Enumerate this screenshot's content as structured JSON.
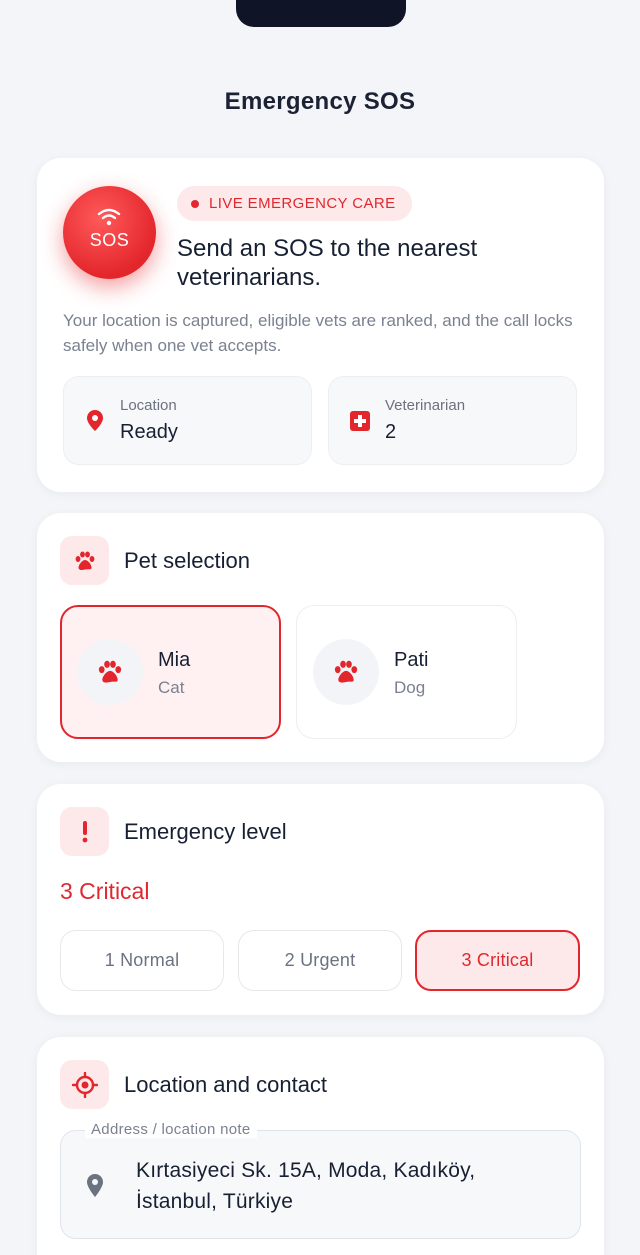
{
  "header": {
    "title": "Emergency SOS"
  },
  "sos": {
    "button_label": "SOS",
    "badge": "LIVE EMERGENCY CARE",
    "heading": "Send an SOS to the nearest veterinarians.",
    "description": "Your location is captured, eligible vets are ranked, and the call locks safely when one vet accepts.",
    "location": {
      "label": "Location",
      "value": "Ready"
    },
    "veterinarian": {
      "label": "Veterinarian",
      "value": "2"
    }
  },
  "pets": {
    "title": "Pet selection",
    "items": [
      {
        "name": "Mia",
        "type": "Cat",
        "selected": true
      },
      {
        "name": "Pati",
        "type": "Dog",
        "selected": false
      }
    ]
  },
  "emergency": {
    "title": "Emergency level",
    "current": "3 Critical",
    "levels": [
      {
        "label": "1 Normal",
        "selected": false
      },
      {
        "label": "2 Urgent",
        "selected": false
      },
      {
        "label": "3 Critical",
        "selected": true
      }
    ]
  },
  "location_contact": {
    "title": "Location and contact",
    "address_label": "Address / location note",
    "address_value": "Kırtasiyeci Sk. 15A, Moda, Kadıköy, İstanbul, Türkiye"
  },
  "colors": {
    "accent": "#e3262c",
    "accent_soft": "#fde8ea",
    "background": "#f3f5f8"
  }
}
